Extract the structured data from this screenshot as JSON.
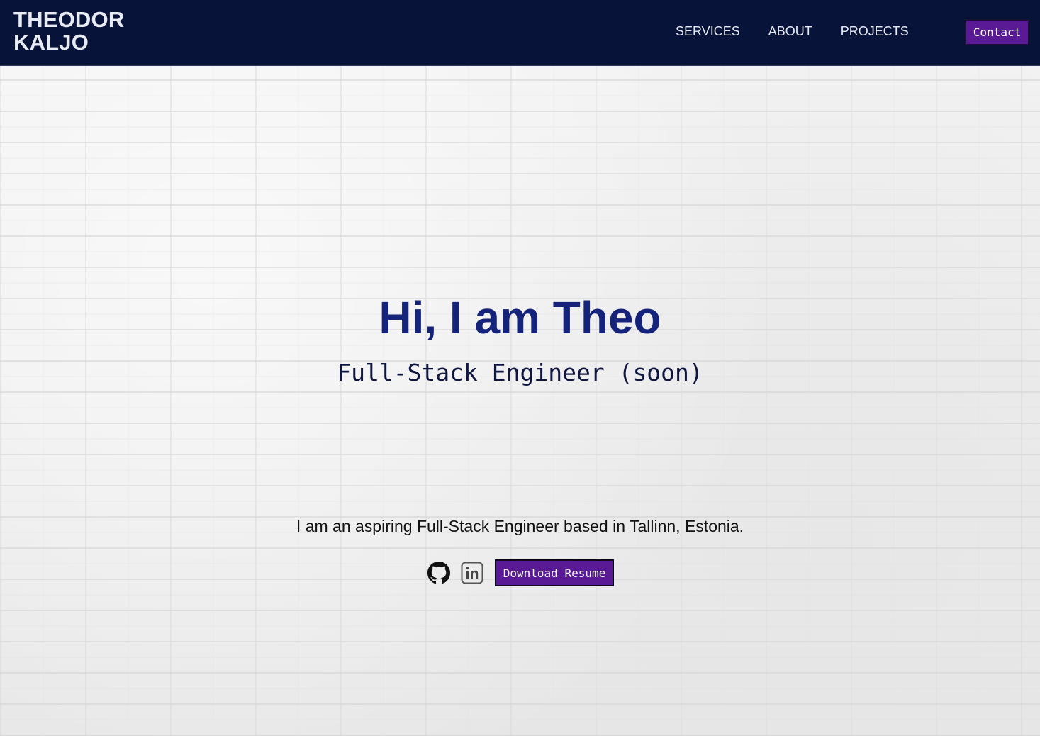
{
  "header": {
    "logo_line1": "THEODOR",
    "logo_line2": "KALJO",
    "nav": [
      {
        "label": "SERVICES"
      },
      {
        "label": "ABOUT"
      },
      {
        "label": "PROJECTS"
      }
    ],
    "contact_label": "Contact",
    "background_color": "#08133a",
    "accent_color": "#5a1a96"
  },
  "hero": {
    "title": "Hi, I am Theo",
    "subtitle": "Full-Stack Engineer (soon)",
    "title_color": "#16237a"
  },
  "intro": {
    "text": "I am an aspiring Full-Stack Engineer based in Tallinn, Estonia."
  },
  "actions": {
    "github_icon": "github-icon",
    "linkedin_icon": "linkedin-icon",
    "resume_label": "Download Resume"
  }
}
